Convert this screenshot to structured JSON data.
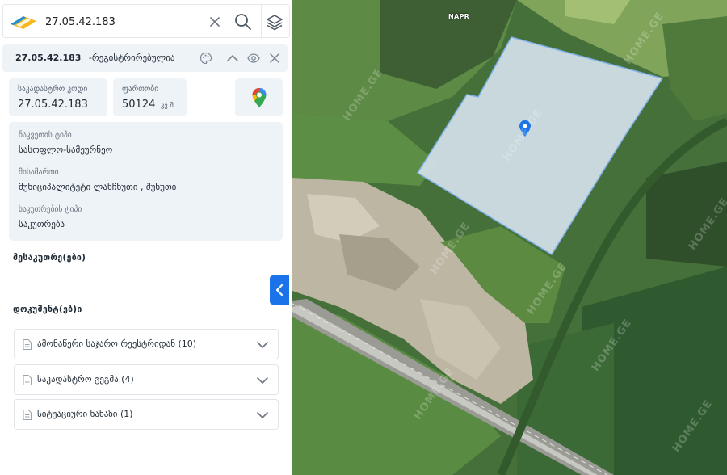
{
  "search": {
    "value": "27.05.42.183",
    "placeholder": ""
  },
  "header": {
    "code": "27.05.42.183",
    "status": "-რეგისტრირებულია"
  },
  "cards": {
    "cadastral_code_label": "საკადასტრო კოდი",
    "cadastral_code_value": "27.05.42.183",
    "area_label": "ფართობი",
    "area_value": "50124",
    "area_unit": "კვ.მ."
  },
  "details": {
    "land_type_label": "ნაკვეთის ტიპი",
    "land_type_value": "სასოფლო-სამეურნეო",
    "address_label": "მისამართი",
    "address_value": "მუნიციპალიტეტი ლანჩხუთი , შუხუთი",
    "ownership_type_label": "საკუთრების ტიპი",
    "ownership_type_value": "საკუთრება"
  },
  "sections": {
    "owners_title": "მესაკუთრე(ები)",
    "documents_title": "დოკუმენტ(ებ)ი"
  },
  "documents": [
    {
      "label": "ამონაწერი საჯარო რეესტრიდან (10)"
    },
    {
      "label": "საკადასტრო გეგმა (4)"
    },
    {
      "label": "სიტუაციური ნახაზი (1)"
    }
  ],
  "map": {
    "label": "NAPR",
    "watermark": "HOME.GE",
    "parcel_fill": "#dbe6f3",
    "parcel_stroke": "#7fb0e6",
    "marker_color": "#1a73e8"
  },
  "colors": {
    "accent": "#1a73e8",
    "card_bg": "#eef3f8"
  },
  "icons": {
    "logo": "napr-logo",
    "clear": "close-icon",
    "search": "search-icon",
    "layers": "layers-icon",
    "palette": "palette-icon",
    "collapse": "chevron-up-icon",
    "visibility": "eye-icon",
    "close": "close-icon",
    "maps": "google-maps-pin-icon",
    "document": "document-icon",
    "expand": "chevron-down-icon",
    "panel_toggle": "chevron-left-icon"
  }
}
